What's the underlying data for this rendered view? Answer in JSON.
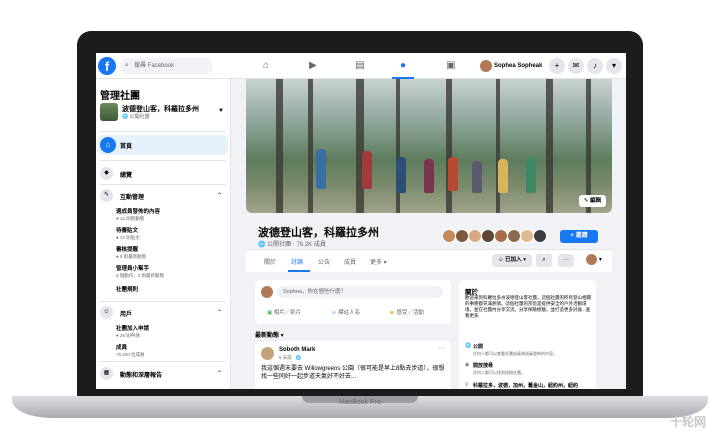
{
  "topbar": {
    "search_placeholder": "搜尋 Facebook",
    "user_name": "Sophea Sopheak",
    "logo": "f"
  },
  "sidebar": {
    "title": "管理社團",
    "group_name": "波德登山客，科羅拉多州",
    "group_privacy": "公開社團",
    "home_label": "首頁",
    "overview_label": "總覽",
    "engagement_label": "互動管理",
    "engagement_items": [
      {
        "title": "適成員發佈的內容",
        "sub": "12 則新動態"
      },
      {
        "title": "待審貼文",
        "sub": "17 則貼文"
      },
      {
        "title": "審核提醒",
        "sub": "5 則最新動態"
      },
      {
        "title": "管理員小幫手",
        "sub": "3 個動作，2 則最新動態"
      },
      {
        "title": "社團規則",
        "sub": ""
      }
    ],
    "members_label": "用戶",
    "members_items": [
      {
        "title": "社團加入申請",
        "sub": "26 則申請"
      },
      {
        "title": "成員",
        "sub": "76,200 位成員"
      }
    ],
    "insights_label": "動態和深層報告"
  },
  "cover": {
    "edit_label": "編輯"
  },
  "group": {
    "title": "波德登山客，科羅拉多州",
    "sub": "公開社團 · 76.2K 成員",
    "invite_label": "+ 邀請",
    "joined_label": "已加入"
  },
  "tabs": [
    "關於",
    "討論",
    "公告",
    "成員",
    "更多"
  ],
  "composer": {
    "placeholder": "Sophea，你在想些什麼？",
    "photo": "相片／影片",
    "tag": "標註人名",
    "feeling": "感受／活動"
  },
  "feed": {
    "label": "最新動態",
    "post": {
      "author": "Soboth Mark",
      "time": "5 天前",
      "body": "我這個週末要去 Willowgreens 公園（很可能是早上8點去步道），很想找一些同好一起步道天氣好不好去..."
    }
  },
  "about": {
    "heading": "關於",
    "desc": "歡迎來到科羅拉多州波德登山客社團，這個社團的所有登山相關的事務都充滿熱情。這個社團的宗旨是提供安全的戶外活動環境，並在社團內分享交流。分享探險經驗，並打造更多討論...查看更多",
    "rows": [
      {
        "icon": "globe-icon",
        "title": "公開",
        "sub": "任何人都可以查看社團成員和成員發佈的內容。"
      },
      {
        "icon": "eye-icon",
        "title": "開放搜尋",
        "sub": "任何人都可以找到這個社團。"
      },
      {
        "icon": "pin-icon",
        "title": "科羅拉多，波德，加州，舊金山，紐約州，紐約",
        "sub": ""
      }
    ]
  },
  "device": {
    "label": "MacBook Pro"
  },
  "watermark": "十轮网"
}
